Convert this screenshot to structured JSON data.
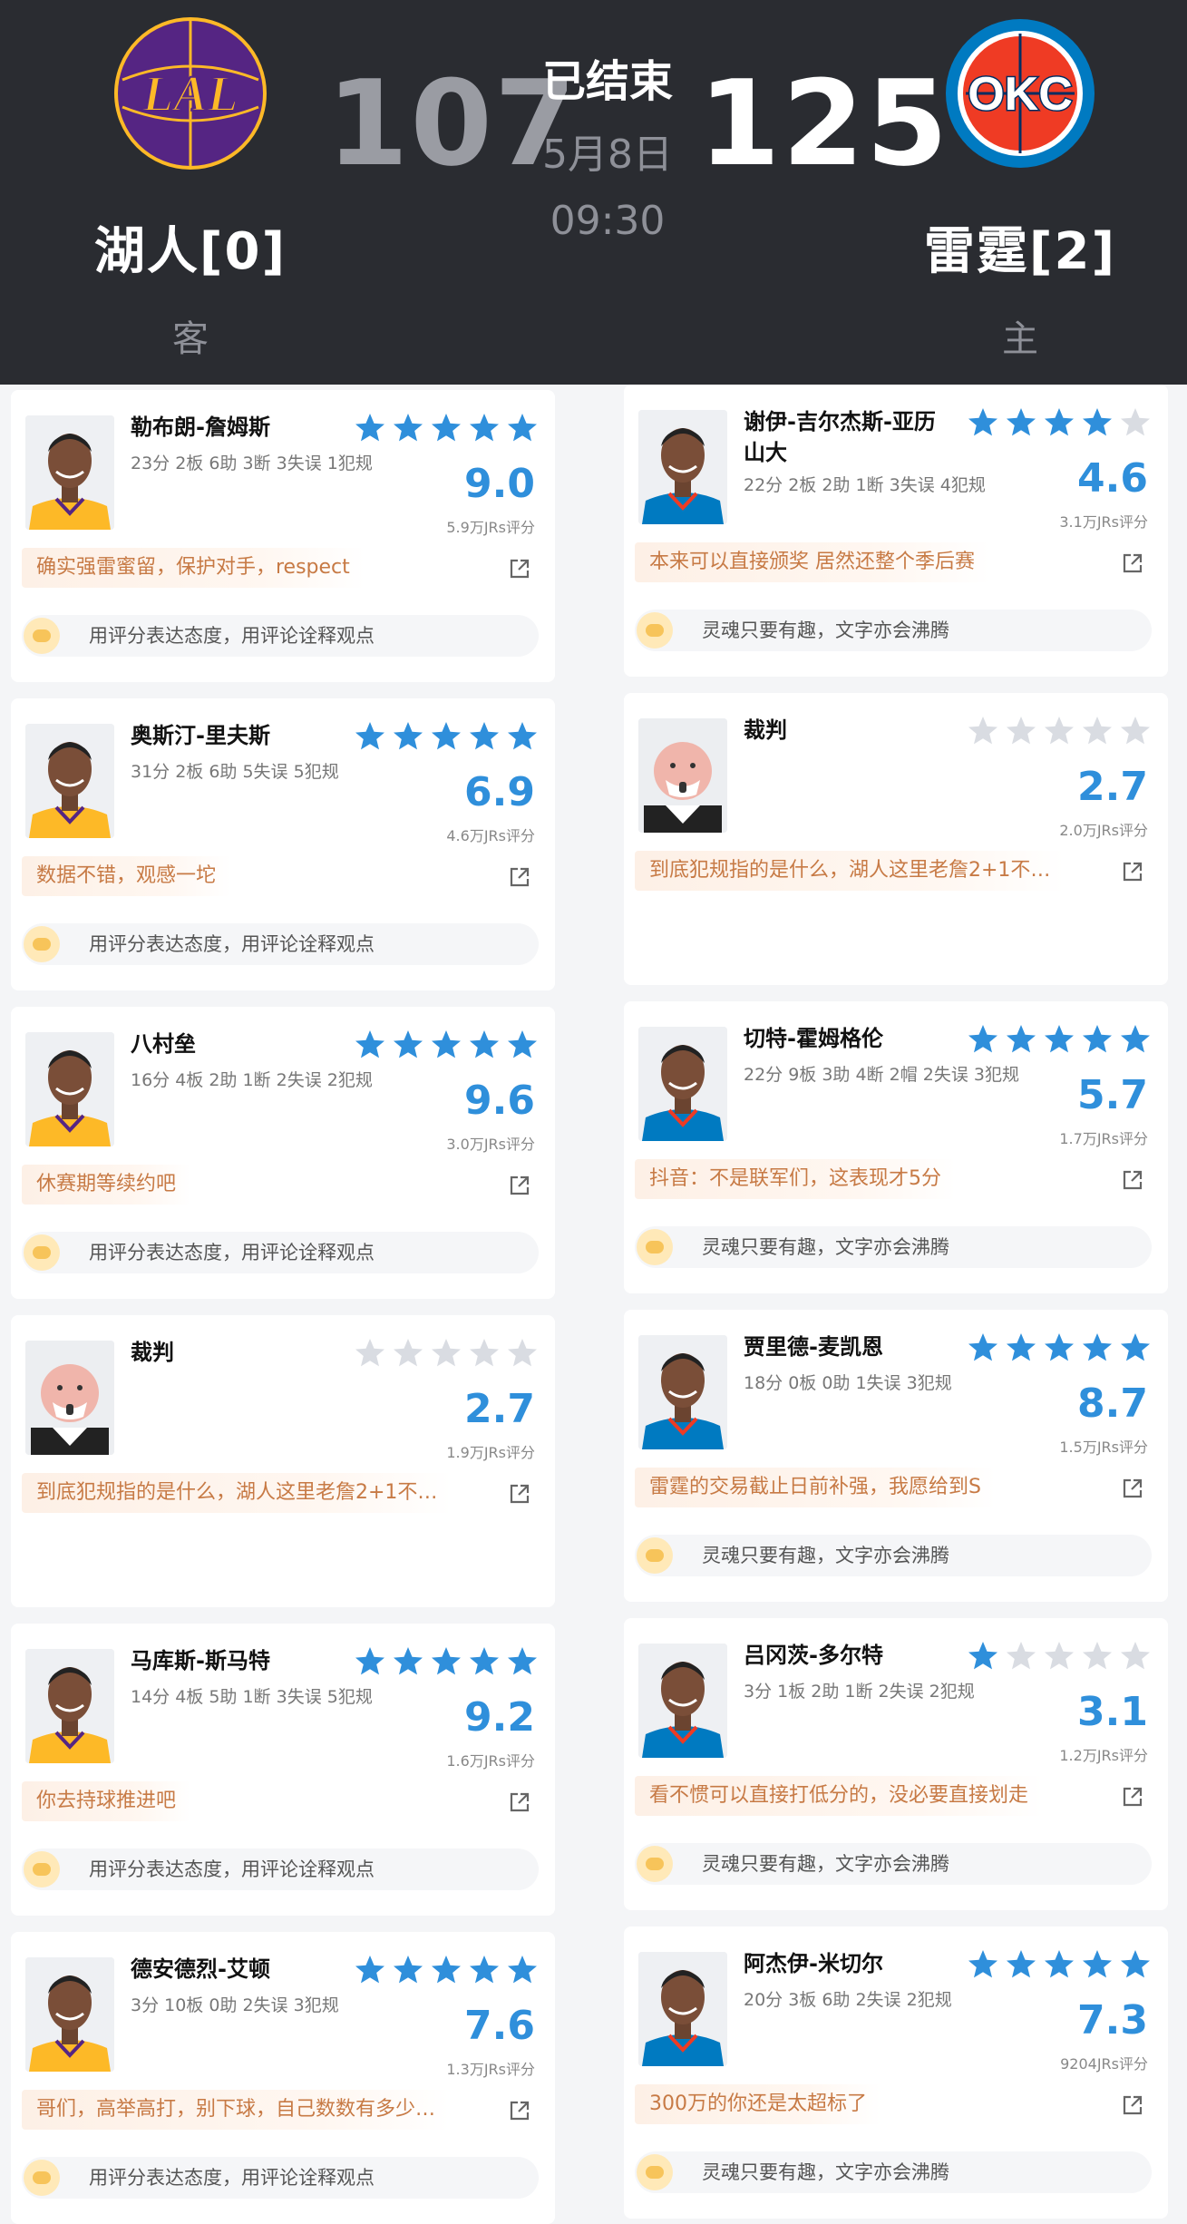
{
  "header": {
    "status": "已结束",
    "date": "5月8日",
    "time": "09:30",
    "away": {
      "logo_text": "LAL",
      "score": "107",
      "name": "湖人[0]",
      "role": "客",
      "color": "#552583",
      "accent": "#fdb927"
    },
    "home": {
      "logo_text": "OKC",
      "score": "125",
      "name": "雷霆[2]",
      "role": "主",
      "color": "#007ac1",
      "accent": "#ef3b24"
    }
  },
  "colors": {
    "star_on": "#2f8fdb",
    "star_off": "#d9dce2",
    "rating": "#2f8fdb",
    "comment": "#c77a45"
  },
  "left_cards": [
    {
      "name": "勒布朗-詹姆斯",
      "stats": "23分 2板 6助 3断 3失误 1犯规",
      "stars": 5,
      "rating": "9.0",
      "votes": "5.9万JRs评分",
      "comment": "确实强雷蜜留，保护对手，respect",
      "prompt": "用评分表达态度，用评论诠释观点",
      "photo": "lakers"
    },
    {
      "name": "奥斯汀-里夫斯",
      "stats": "31分 2板 6助 5失误 5犯规",
      "stars": 5,
      "rating": "6.9",
      "votes": "4.6万JRs评分",
      "comment": "数据不错，观感一坨",
      "prompt": "用评分表达态度，用评论诠释观点",
      "photo": "lakers"
    },
    {
      "name": "八村垒",
      "stats": "16分 4板 2助 1断 2失误 2犯规",
      "stars": 5,
      "rating": "9.6",
      "votes": "3.0万JRs评分",
      "comment": "休赛期等续约吧",
      "prompt": "用评分表达态度，用评论诠释观点",
      "photo": "lakers"
    },
    {
      "name": "裁判",
      "stats": "",
      "stars": 0,
      "rating": "2.7",
      "votes": "1.9万JRs评分",
      "comment": "到底犯规指的是什么，湖人这里老詹2+1不…",
      "prompt": "",
      "photo": "referee"
    },
    {
      "name": "马库斯-斯马特",
      "stats": "14分 4板 5助 1断 3失误 5犯规",
      "stars": 5,
      "rating": "9.2",
      "votes": "1.6万JRs评分",
      "comment": "你去持球推进吧",
      "prompt": "用评分表达态度，用评论诠释观点",
      "photo": "lakers"
    },
    {
      "name": "德安德烈-艾顿",
      "stats": "3分 10板 0助 2失误 3犯规",
      "stars": 5,
      "rating": "7.6",
      "votes": "1.3万JRs评分",
      "comment": "哥们，高举高打，别下球，自己数数有多少…",
      "prompt": "用评分表达态度，用评论诠释观点",
      "photo": "lakers"
    }
  ],
  "right_cards": [
    {
      "name": "谢伊-吉尔杰斯-亚历山大",
      "stats": "22分 2板 2助 1断 3失误 4犯规",
      "stars": 4,
      "rating": "4.6",
      "votes": "3.1万JRs评分",
      "comment": "本来可以直接颁奖 居然还整个季后赛",
      "prompt": "灵魂只要有趣，文字亦会沸腾",
      "photo": "thunder"
    },
    {
      "name": "裁判",
      "stats": "",
      "stars": 0,
      "rating": "2.7",
      "votes": "2.0万JRs评分",
      "comment": "到底犯规指的是什么，湖人这里老詹2+1不…",
      "prompt": "",
      "photo": "referee"
    },
    {
      "name": "切特-霍姆格伦",
      "stats": "22分 9板 3助 4断 2帽 2失误 3犯规",
      "stars": 5,
      "rating": "5.7",
      "votes": "1.7万JRs评分",
      "comment": "抖音：不是联军们，这表现才5分",
      "prompt": "灵魂只要有趣，文字亦会沸腾",
      "photo": "thunder"
    },
    {
      "name": "贾里德-麦凯恩",
      "stats": "18分 0板 0助 1失误 3犯规",
      "stars": 5,
      "rating": "8.7",
      "votes": "1.5万JRs评分",
      "comment": "雷霆的交易截止日前补强，我愿给到S",
      "prompt": "灵魂只要有趣，文字亦会沸腾",
      "photo": "thunder"
    },
    {
      "name": "吕冈茨-多尔特",
      "stats": "3分 1板 2助 1断 2失误 2犯规",
      "stars": 1,
      "rating": "3.1",
      "votes": "1.2万JRs评分",
      "comment": "看不惯可以直接打低分的，没必要直接划走",
      "prompt": "灵魂只要有趣，文字亦会沸腾",
      "photo": "thunder"
    },
    {
      "name": "阿杰伊-米切尔",
      "stats": "20分 3板 6助 2失误 2犯规",
      "stars": 5,
      "rating": "7.3",
      "votes": "9204JRs评分",
      "comment": "300万的你还是太超标了",
      "prompt": "灵魂只要有趣，文字亦会沸腾",
      "photo": "thunder"
    }
  ]
}
